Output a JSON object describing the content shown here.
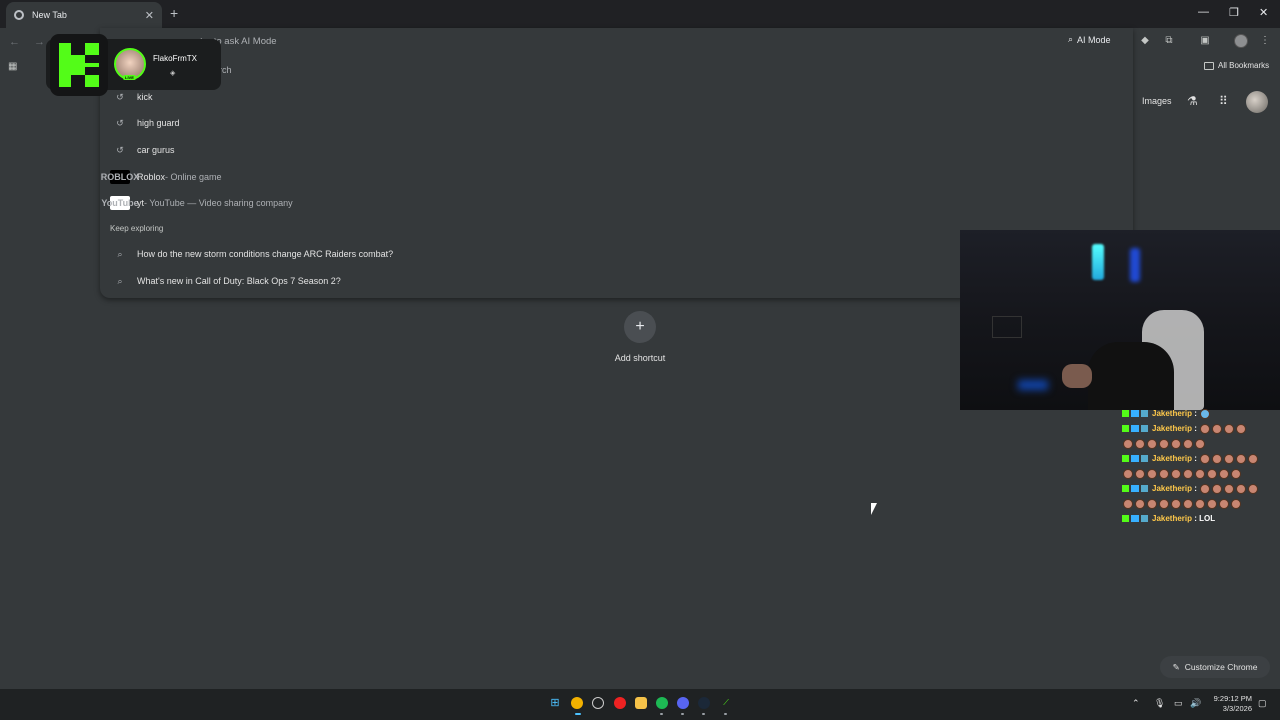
{
  "browser": {
    "tab_title": "New Tab",
    "omnibox_hint": "ter to ask AI Mode",
    "omnibox_hint_row2": "arch",
    "ai_mode_label": "AI Mode",
    "all_bookmarks_label": "All Bookmarks"
  },
  "page": {
    "images_label": "Images",
    "add_shortcut_label": "Add shortcut",
    "customize_label": "Customize Chrome"
  },
  "suggestions": {
    "history": [
      "kick",
      "high guard",
      "car gurus"
    ],
    "roblox": {
      "title": "Roblox",
      "desc": " - Online game",
      "icon_text": "ROBLOX"
    },
    "youtube": {
      "title": "yt",
      "desc": " - YouTube — Video sharing company",
      "icon_text": "YouTube"
    },
    "section_label": "Keep exploring",
    "explore": [
      "How do the new storm conditions change ARC Raiders combat?",
      "What's new in Call of Duty: Black Ops 7 Season 2?"
    ]
  },
  "kick_overlay": {
    "streamer_name": "FlakoFrmTX",
    "live_label": "LIVE"
  },
  "chat": {
    "lines": [
      {
        "user": "Jaketherip",
        "text": ""
      },
      {
        "user": "Jaketherip",
        "text": ""
      },
      {
        "user": "Jaketherip",
        "text": ""
      },
      {
        "user": "Jaketherip",
        "text": ""
      },
      {
        "user": "Jaketherip",
        "text": "LOL"
      }
    ],
    "separator": " : "
  },
  "taskbar": {
    "time": "9:29:12 PM",
    "date": "3/3/2026"
  }
}
